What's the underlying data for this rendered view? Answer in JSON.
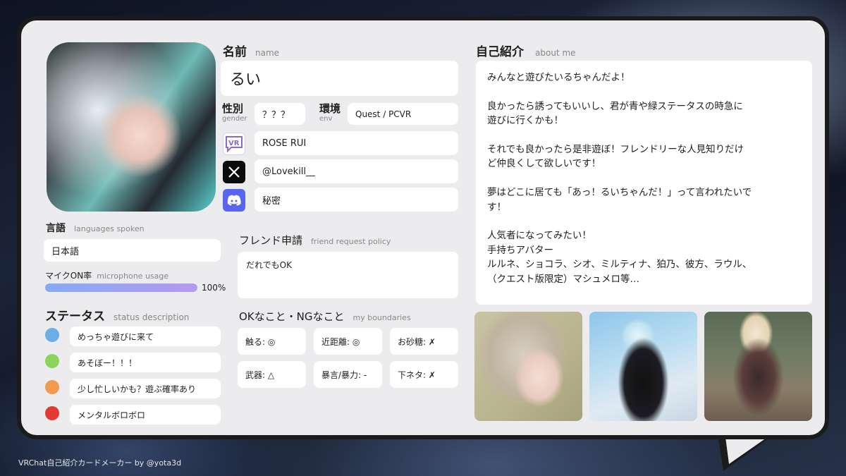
{
  "name": {
    "label": "名前",
    "sub": "name",
    "value": "るい"
  },
  "gender": {
    "label": "性別",
    "sub": "gender",
    "value": "？？？"
  },
  "env": {
    "label": "環境",
    "sub": "env",
    "value": "Quest / PCVR"
  },
  "socials": {
    "vrchat": {
      "icon": "vrchat-icon",
      "value": "ROSE RUI"
    },
    "x": {
      "icon": "x-logo-icon",
      "value": "@Lovekill__"
    },
    "discord": {
      "icon": "discord-icon",
      "value": "秘密"
    }
  },
  "languages": {
    "label": "言語",
    "sub": "languages spoken",
    "value": "日本語"
  },
  "mic": {
    "label": "マイクON率",
    "sub": "microphone usage",
    "percent": 100,
    "percent_text": "100%"
  },
  "status": {
    "label": "ステータス",
    "sub": "status description",
    "items": [
      {
        "color": "#6aaee8",
        "text": "めっちゃ遊びに来て"
      },
      {
        "color": "#8ad45c",
        "text": "あそぼー！！！"
      },
      {
        "color": "#f39a4e",
        "text": "少し忙しいかも？遊ぶ確率あり"
      },
      {
        "color": "#e23a2e",
        "text": "メンタルボロボロ"
      }
    ]
  },
  "friend": {
    "label": "フレンド申請",
    "sub": "friend request policy",
    "value": "だれでもOK"
  },
  "boundaries": {
    "label": "OKなこと・NGなこと",
    "sub": "my boundaries",
    "items": [
      "触る: ◎",
      "近距離: ◎",
      "お砂糖: ✗",
      "武器: △",
      "暴言/暴力: -",
      "下ネタ: ✗"
    ]
  },
  "about": {
    "label": "自己紹介",
    "sub": "about me",
    "lines": [
      "みんなと遊びたいるちゃんだよ！",
      "",
      "良かったら誘ってもいいし、君が青や緑ステータスの時急に",
      "遊びに行くかも！",
      "",
      "それでも良かったら是非遊ぼ！フレンドリーな人見知りだけ",
      "ど仲良くして欲しいです！",
      "",
      "夢はどこに居ても「あっ！るいちゃんだ！」って言われたいで",
      "す！",
      "",
      "人気者になってみたい！",
      "手持ちアバター",
      "ルルネ、ショコラ、シオ、ミルティナ、狛乃、彼方、ラウル、",
      "（クエスト版限定）マシュメロ等…"
    ]
  },
  "credit": "VRChat自己紹介カードメーカー by @yota3d",
  "colors": {
    "mic_bar_start": "#86aaf2",
    "mic_bar_end": "#b59af0",
    "card_border": "#1b1b1b",
    "card_bg": "#ececef"
  }
}
